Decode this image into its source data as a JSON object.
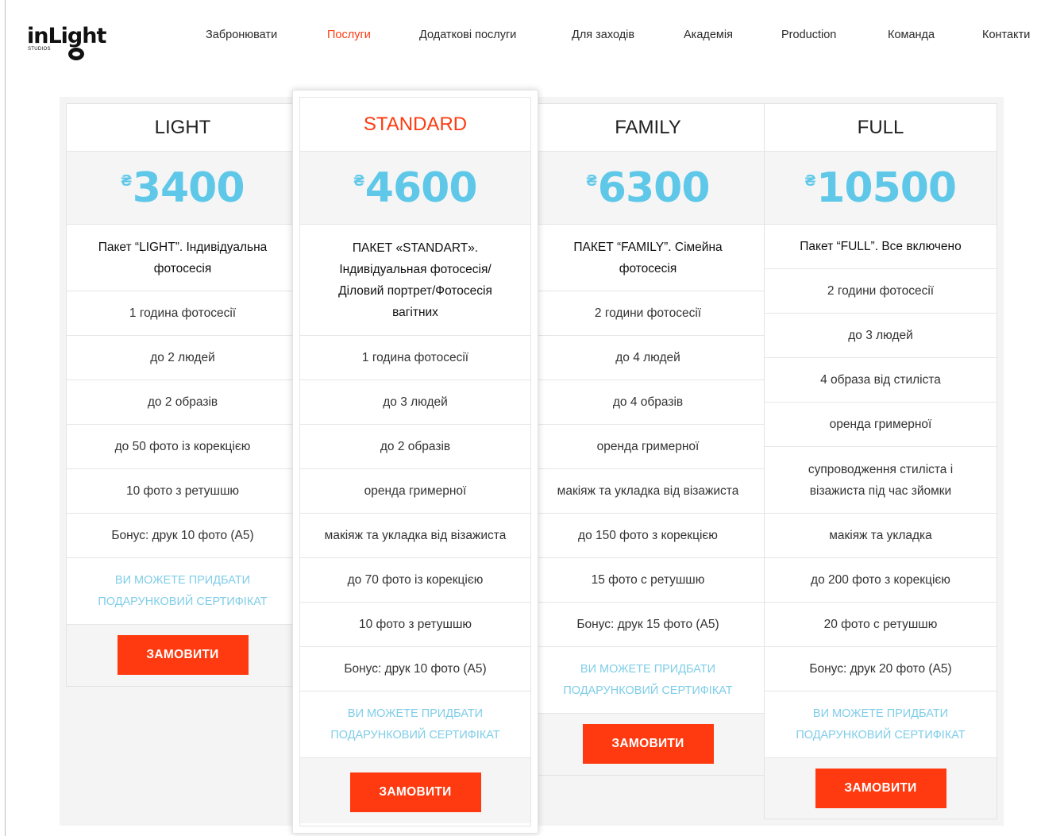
{
  "brand": {
    "logo": "inLight",
    "sub": "STUDIOS"
  },
  "nav": [
    {
      "label": "Забронювати",
      "active": false
    },
    {
      "label": "Послуги",
      "active": true
    },
    {
      "label": "Додаткові послуги",
      "active": false
    },
    {
      "label": "Для заходів",
      "active": false
    },
    {
      "label": "Академія",
      "active": false
    },
    {
      "label": "Production",
      "active": false
    },
    {
      "label": "Команда",
      "active": false
    },
    {
      "label": "Контакти",
      "active": false
    }
  ],
  "plans": [
    {
      "name": "LIGHT",
      "currency": "₴",
      "price": "3400",
      "title": "Пакет “LIGHT”. Індивідуальна фотосесія",
      "features": [
        "1 година фотосесії",
        "до 2 людей",
        "до 2 образів",
        "до 50 фото із корекцією",
        "10 фото з ретушшю",
        "Бонус: друк 10 фото (А5)"
      ],
      "cert": "ВИ МОЖЕТЕ ПРИДБАТИ ПОДАРУНКОВИЙ СЕРТИФІКАТ",
      "button": "ЗАМОВИТИ"
    },
    {
      "name": "STANDARD",
      "currency": "₴",
      "price": "4600",
      "title": "ПАКЕТ «STANDART». Індивідуальная фотосесія/ Діловий портрет/Фотосесія вагітних",
      "features": [
        "1 година фотосесії",
        "до 3 людей",
        "до 2 образів",
        "оренда гримерної",
        "макіяж та укладка від візажиста",
        "до 70 фото із корекцією",
        "10 фото з ретушшю",
        "Бонус: друк 10 фото (А5)"
      ],
      "cert": "ВИ МОЖЕТЕ ПРИДБАТИ ПОДАРУНКОВИЙ СЕРТИФІКАТ",
      "button": "ЗАМОВИТИ"
    },
    {
      "name": "FAMILY",
      "currency": "₴",
      "price": "6300",
      "title": "ПАКЕТ “FAMILY”. Сімейна фотосесія",
      "features": [
        "2 години фотосесії",
        "до 4 людей",
        "до 4 образів",
        "оренда гримерної",
        "макіяж та укладка від візажиста",
        "до 150 фото з корекцією",
        "15 фото с ретушшю",
        "Бонус: друк 15 фото (А5)"
      ],
      "cert": "ВИ МОЖЕТЕ ПРИДБАТИ ПОДАРУНКОВИЙ СЕРТИФІКАТ",
      "button": "ЗАМОВИТИ"
    },
    {
      "name": "FULL",
      "currency": "₴",
      "price": "10500",
      "title": "Пакет “FULL”. Все включено",
      "features": [
        "2 години фотосесії",
        "до 3 людей",
        "4 образа від стиліста",
        "оренда гримерної",
        "супроводження стиліста і візажиста під час зйомки",
        "макіяж та укладка",
        "до 200 фото з корекцією",
        "20 фото с ретушшю",
        "Бонус: друк 20 фото (А5)"
      ],
      "cert": "ВИ МОЖЕТЕ ПРИДБАТИ ПОДАРУНКОВИЙ СЕРТИФІКАТ",
      "button": "ЗАМОВИТИ"
    }
  ],
  "colors": {
    "accent": "#ff3a10",
    "price": "#5fc8e8",
    "cert": "#7fcde8"
  }
}
